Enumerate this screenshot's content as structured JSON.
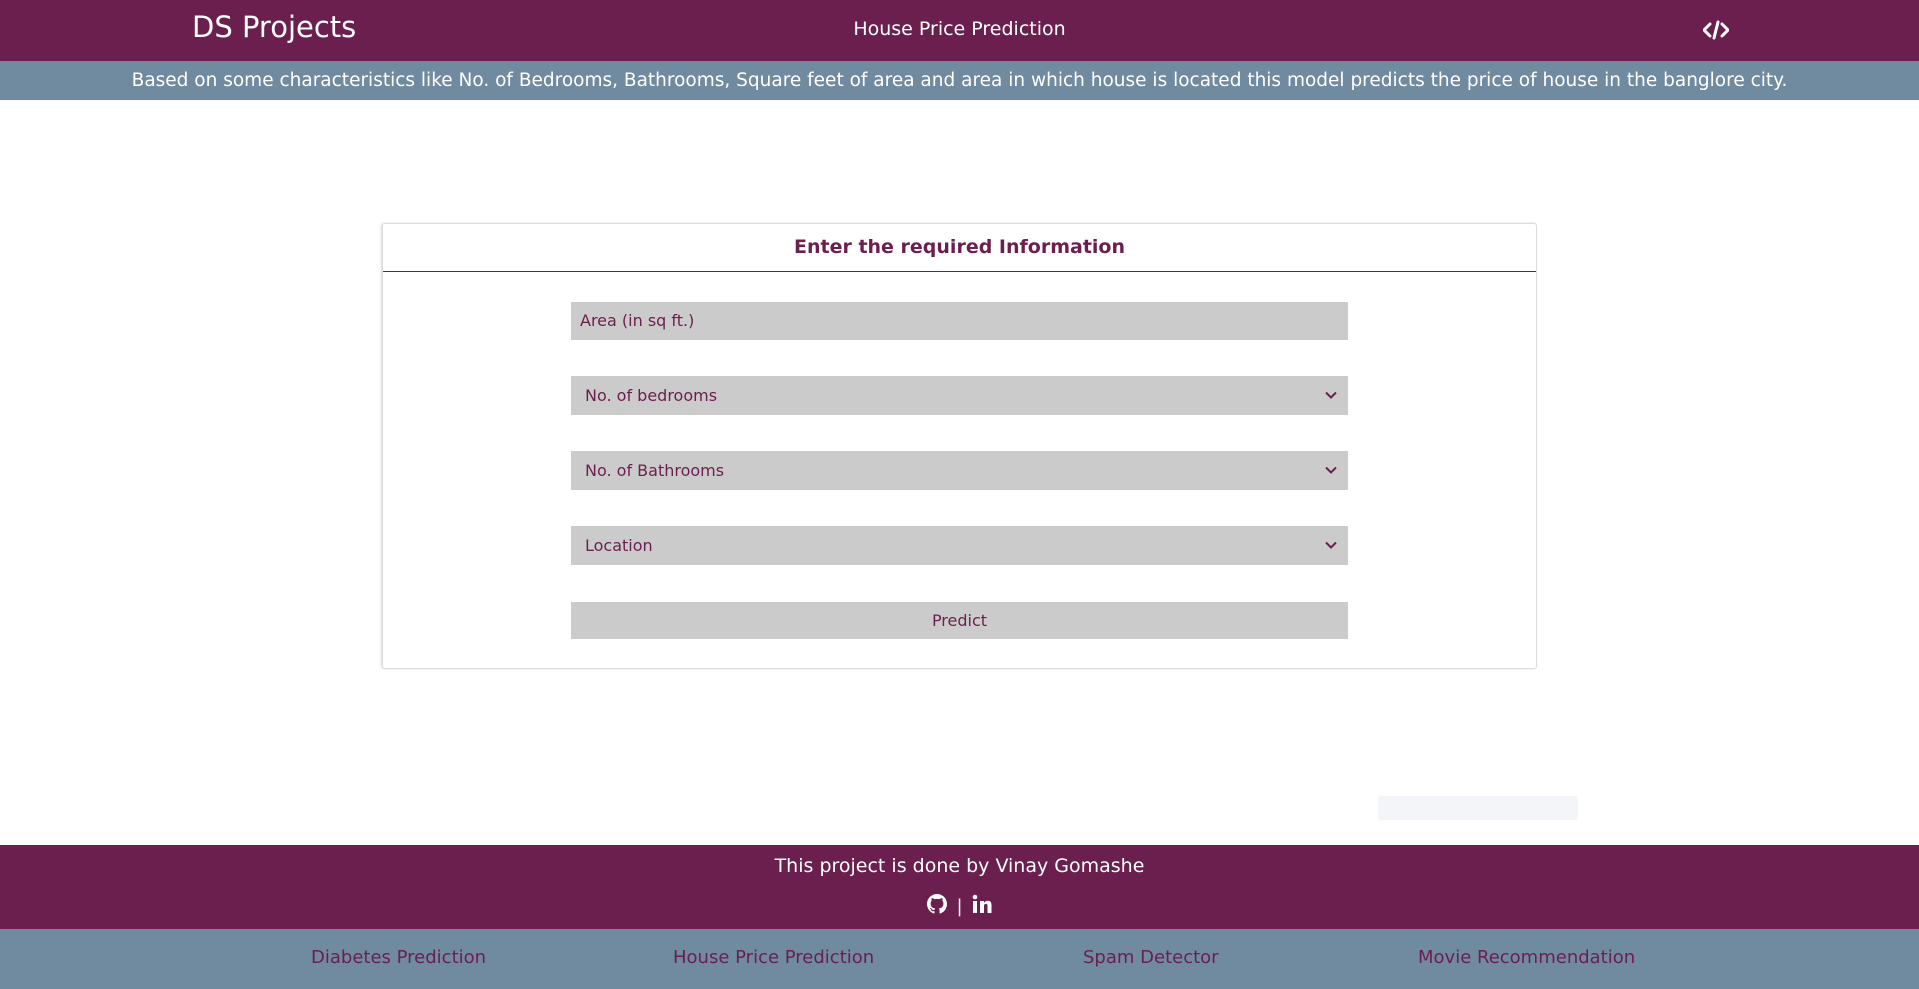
{
  "header": {
    "brand": "DS Projects",
    "title": "House Price Prediction",
    "code_icon": "code-icon"
  },
  "description": "Based on some characteristics like No. of Bedrooms, Bathrooms, Square feet of area and area in which house is located this model predicts the price of house in the banglore city.",
  "form": {
    "heading": "Enter the required Information",
    "area_placeholder": "Area (in sq ft.)",
    "bedrooms_selected": "No. of bedrooms",
    "bathrooms_selected": "No. of Bathrooms",
    "location_selected": "Location",
    "predict_label": "Predict"
  },
  "footer": {
    "credit": "This project is done by Vinay Gomashe",
    "separator": "|",
    "icons": [
      "github-icon",
      "linkedin-icon"
    ]
  },
  "bottom_nav": {
    "items": [
      "Diabetes Prediction",
      "House Price Prediction",
      "Spam Detector",
      "Movie Recommendation"
    ]
  },
  "colors": {
    "primary": "#6b1f4f",
    "secondary": "#708aa0",
    "field_bg": "#cbcbcb"
  }
}
